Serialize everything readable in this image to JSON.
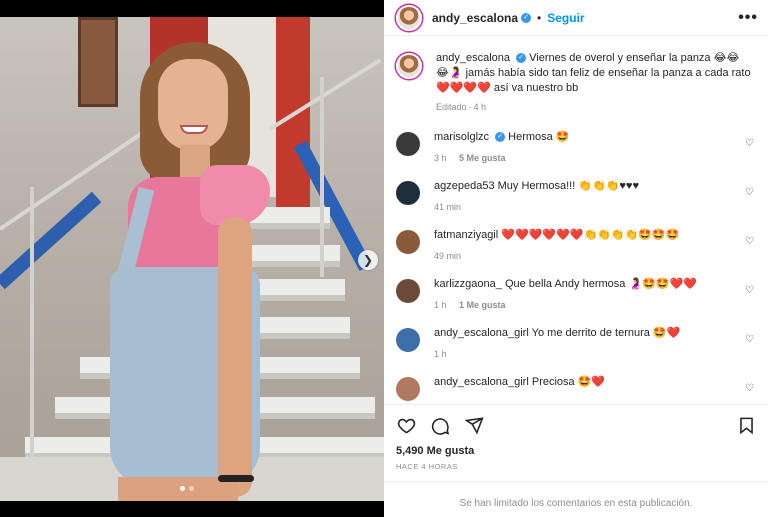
{
  "post": {
    "author": "andy_escalona",
    "follow_label": "Seguir",
    "more_label": "•••"
  },
  "caption": {
    "author": "andy_escalona",
    "text": "Viernes de overol y enseñar la panza 😂😂😂🤰 jamás había sido tan feliz de enseñar la panza a cada rato ❤️❤️❤️❤️ así va nuestro bb",
    "edited": "Editado",
    "time": "4 h"
  },
  "comments": [
    {
      "user": "marisolglzc",
      "verified": true,
      "text": "Hermosa 🤩",
      "time": "3 h",
      "likes": "5 Me gusta",
      "avatar": "#3a3a3a"
    },
    {
      "user": "agzepeda53",
      "verified": false,
      "text": "Muy Hermosa!!! 👏👏👏♥♥♥",
      "time": "41 min",
      "likes": "",
      "avatar": "#1e2e3c"
    },
    {
      "user": "fatmanziyagil",
      "verified": false,
      "text": "❤️❤️❤️❤️❤️❤️👏👏👏👏🤩🤩🤩",
      "time": "49 min",
      "likes": "",
      "avatar": "#8b5a3a"
    },
    {
      "user": "karlizzgaona_",
      "verified": false,
      "text": "Que bella Andy hermosa 🤰🤩🤩❤️❤️",
      "time": "1 h",
      "likes": "1 Me gusta",
      "avatar": "#6b4a3a"
    },
    {
      "user": "andy_escalona_girl",
      "verified": false,
      "text": "Yo me derrito de ternura 🤩❤️",
      "time": "1 h",
      "likes": "",
      "avatar": "#3d6fa8"
    },
    {
      "user": "andy_escalona_girl",
      "verified": false,
      "text": "Preciosa 🤩❤️",
      "time": "",
      "likes": "",
      "avatar": "#b07a60"
    }
  ],
  "stats": {
    "likes": "5,490 Me gusta",
    "ago": "HACE 4 HORAS"
  },
  "footer": {
    "limited": "Se han limitado los comentarios en esta publicación."
  },
  "icons": {
    "like": "heart-icon",
    "comment": "comment-icon",
    "share": "send-icon",
    "save": "bookmark-icon",
    "next": "chevron-right-icon"
  },
  "colors": {
    "follow": "#0095f6",
    "verified": "#3897f0",
    "secondary_text": "#8e8e8e"
  }
}
